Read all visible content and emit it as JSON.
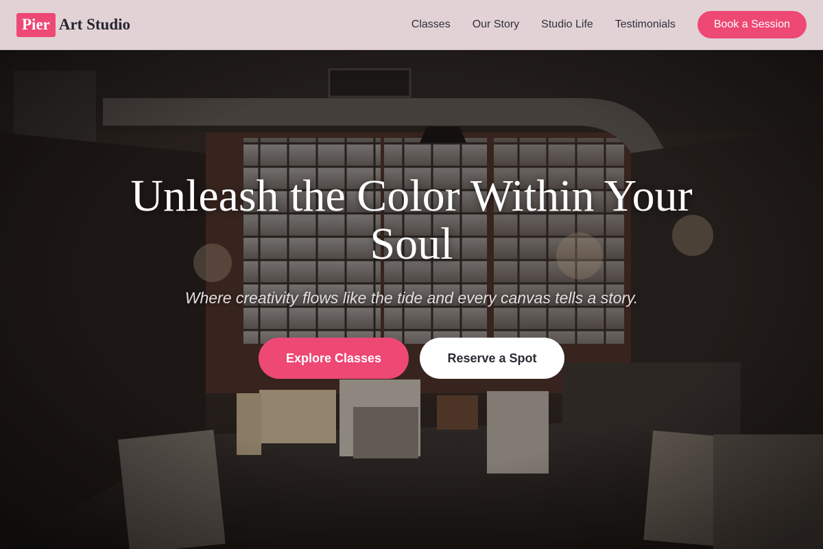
{
  "brand": {
    "badge": "Pier",
    "name": "Art Studio"
  },
  "nav": {
    "links": [
      "Classes",
      "Our Story",
      "Studio Life",
      "Testimonials"
    ],
    "cta": "Book a Session"
  },
  "hero": {
    "title": "Unleash the Color Within Your Soul",
    "subtitle": "Where creativity flows like the tide and every canvas tells a story.",
    "primary_button": "Explore Classes",
    "secondary_button": "Reserve a Spot",
    "background_image": "art studio loft interior with large windows, chandeliers and stacked canvases"
  },
  "colors": {
    "accent": "#ee4874",
    "nav_background": "#e2d2d6",
    "text_dark": "#26262f"
  }
}
